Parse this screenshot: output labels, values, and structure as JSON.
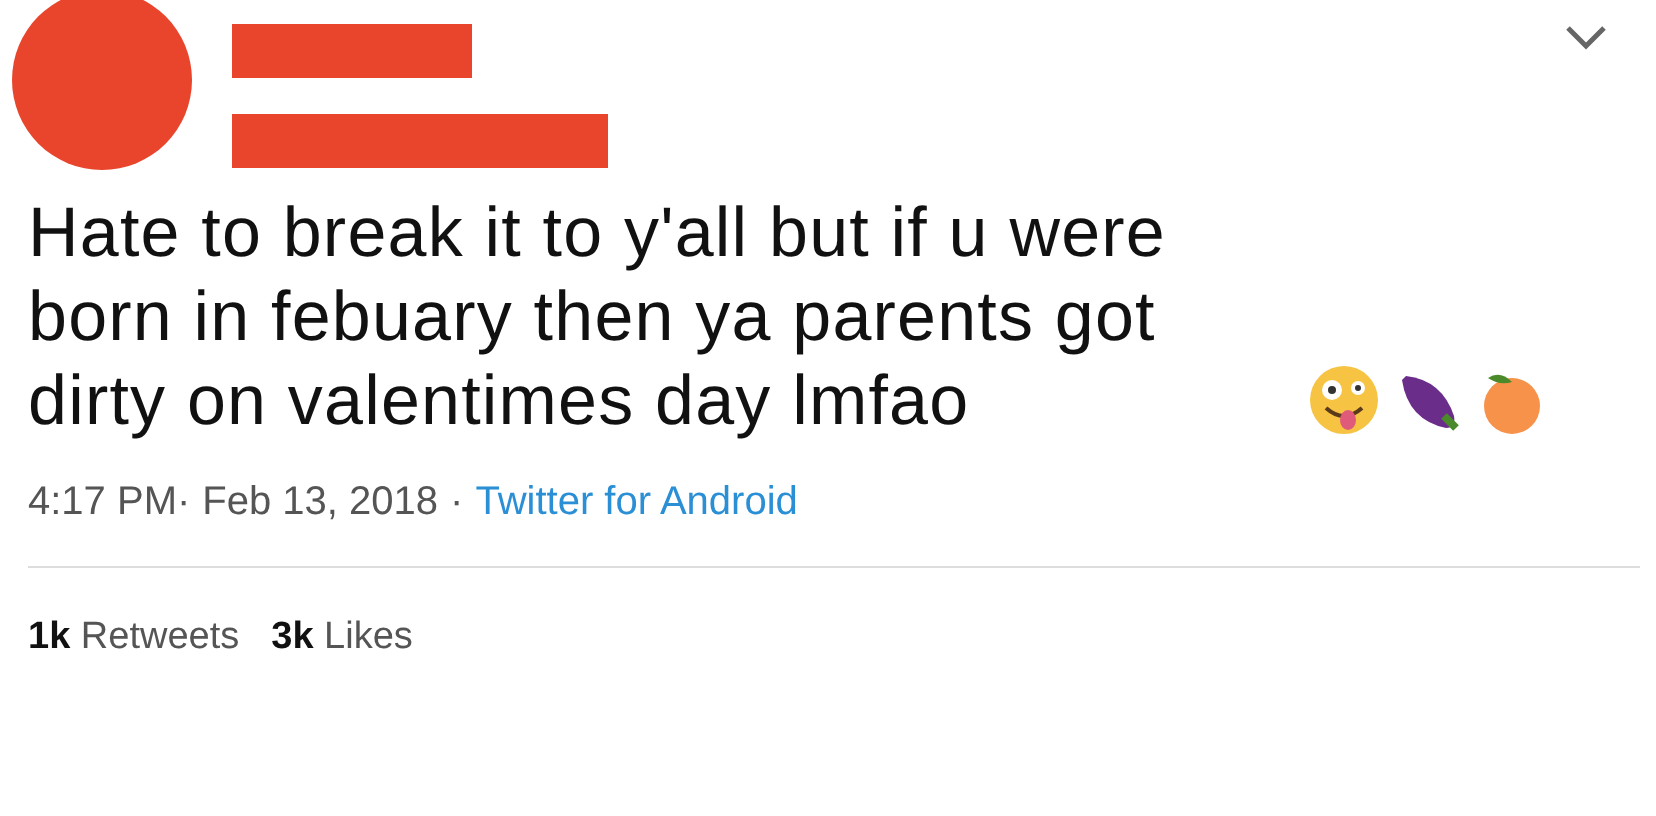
{
  "tweet": {
    "text": "Hate to break it to y'all but if u were born in febuary then ya parents got dirty on valentimes day lmfao",
    "emoji": [
      {
        "kind": "zany-face"
      },
      {
        "kind": "eggplant"
      },
      {
        "kind": "peach"
      }
    ],
    "time": "4:17 PM·",
    "date": "Feb 13, 2018",
    "separator": "·",
    "source": "Twitter for Android"
  },
  "stats": [
    {
      "count": "1k",
      "label": "Retweets"
    },
    {
      "count": "3k",
      "label": "Likes"
    }
  ]
}
